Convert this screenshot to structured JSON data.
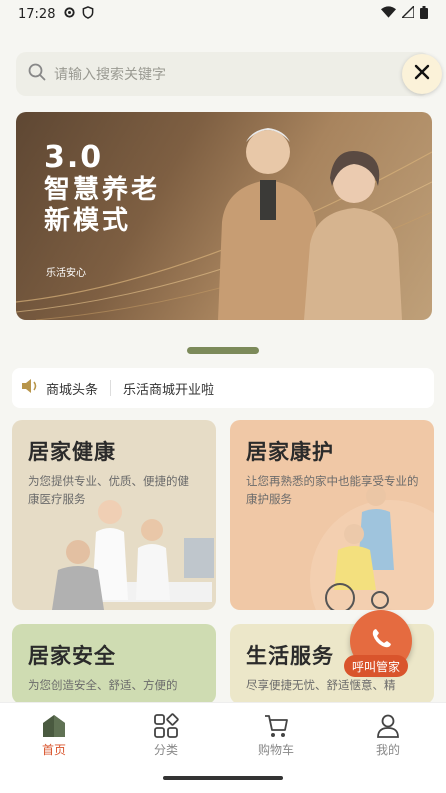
{
  "status_bar": {
    "time": "17:28",
    "icons": [
      "gear-icon",
      "shield-icon",
      "wifi-icon",
      "signal-icon",
      "battery-icon"
    ]
  },
  "search": {
    "placeholder": "请输入搜索关键字",
    "icon": "search-icon",
    "close_icon": "close-icon"
  },
  "banner": {
    "title_line1": "3.0",
    "title_line2": "智慧养老",
    "title_line3": "新模式",
    "subtitle": "乐活安心"
  },
  "news": {
    "icon": "speaker-icon",
    "label": "商城头条",
    "headline": "乐活商城开业啦"
  },
  "cards": [
    {
      "title": "居家健康",
      "desc": "为您提供专业、优质、便捷的健康医疗服务",
      "color": "#e6dcc6"
    },
    {
      "title": "居家康护",
      "desc": "让您再熟悉的家中也能享受专业的康护服务",
      "color": "#f0c8a6"
    },
    {
      "title": "居家安全",
      "desc": "为您创造安全、舒适、方便的",
      "color": "#cfdcb2"
    },
    {
      "title": "生活服务",
      "desc": "尽享便捷无忧、舒适惬意、精",
      "color": "#ece7c9"
    }
  ],
  "call_button": {
    "label": "呼叫管家",
    "icon": "phone-icon",
    "color": "#e56b40"
  },
  "tabs": [
    {
      "label": "首页",
      "icon": "home-icon",
      "active": true
    },
    {
      "label": "分类",
      "icon": "grid-icon",
      "active": false
    },
    {
      "label": "购物车",
      "icon": "cart-icon",
      "active": false
    },
    {
      "label": "我的",
      "icon": "user-icon",
      "active": false
    }
  ],
  "colors": {
    "accent": "#d9542c",
    "pager": "#7c8a5a",
    "background": "#f6f6f2"
  }
}
